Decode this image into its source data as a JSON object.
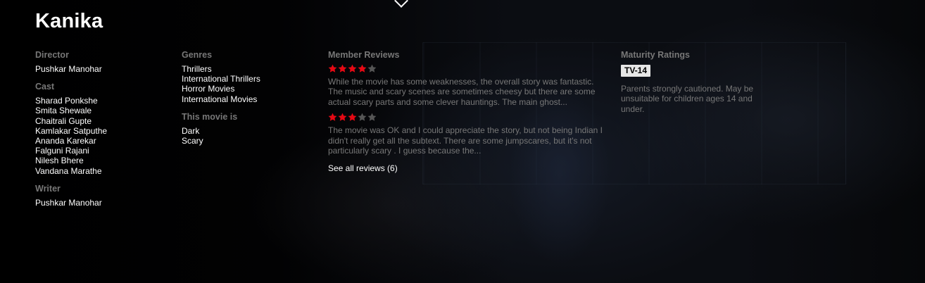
{
  "title": "Kanika",
  "director": {
    "label": "Director",
    "names": [
      "Pushkar Manohar"
    ]
  },
  "cast": {
    "label": "Cast",
    "names": [
      "Sharad Ponkshe",
      "Smita Shewale",
      "Chaitrali Gupte",
      "Kamlakar Satputhe",
      "Ananda Karekar",
      "Falguni Rajani",
      "Nilesh Bhere",
      "Vandana Marathe"
    ]
  },
  "writer": {
    "label": "Writer",
    "names": [
      "Pushkar Manohar"
    ]
  },
  "genres": {
    "label": "Genres",
    "items": [
      "Thrillers",
      "International Thrillers",
      "Horror Movies",
      "International Movies"
    ]
  },
  "movie_is": {
    "label": "This movie is",
    "items": [
      "Dark",
      "Scary"
    ]
  },
  "reviews": {
    "label": "Member Reviews",
    "items": [
      {
        "rating": 4,
        "max": 5,
        "text": "While the movie has some weaknesses, the overall story was fantastic. The music and scary scenes are sometimes cheesy but there are some actual scary parts and some clever hauntings. The main ghost..."
      },
      {
        "rating": 3,
        "max": 5,
        "text": "The movie was OK and I could appreciate the story, but not being Indian I didn't really get all the subtext. There are some jumpscares, but it's not particularly scary . I guess because the..."
      }
    ],
    "see_all": "See all reviews (6)"
  },
  "maturity": {
    "label": "Maturity Ratings",
    "badge": "TV-14",
    "description": "Parents strongly cautioned. May be unsuitable for children ages 14 and under."
  },
  "colors": {
    "star_filled": "#e50914",
    "star_empty": "#555555",
    "label": "#777777",
    "badge_bg": "#e6e6e6"
  }
}
